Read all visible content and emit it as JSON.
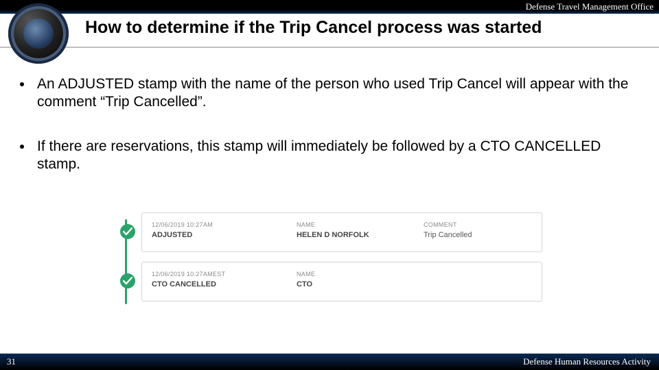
{
  "header": {
    "org": "Defense Travel Management Office"
  },
  "title": "How to determine if the Trip Cancel process was started",
  "bullets": [
    "An ADJUSTED stamp with the name of the person who used Trip Cancel will appear with the comment “Trip Cancelled”.",
    "If there are reservations, this stamp will immediately be followed by a CTO CANCELLED stamp."
  ],
  "stamps": [
    {
      "timestamp": "12/06/2019 10:27AM",
      "status": "ADJUSTED",
      "name_label": "NAME",
      "name": "HELEN D NORFOLK",
      "comment_label": "COMMENT",
      "comment": "Trip Cancelled"
    },
    {
      "timestamp": "12/06/2019 10:27AMEST",
      "status": "CTO CANCELLED",
      "name_label": "NAME",
      "name": "CTO",
      "comment_label": "",
      "comment": ""
    }
  ],
  "footer": {
    "page": "31",
    "org": "Defense Human Resources Activity"
  }
}
